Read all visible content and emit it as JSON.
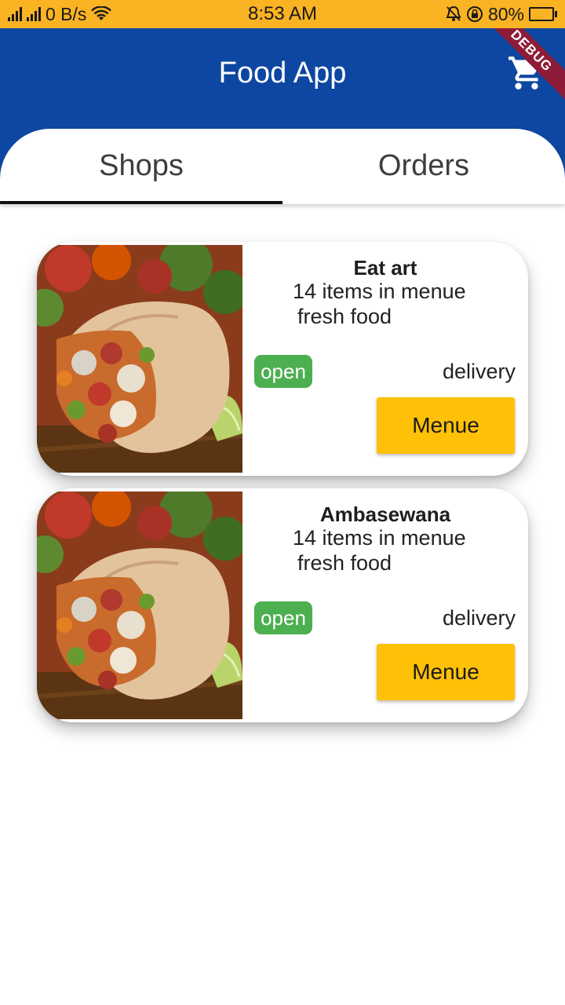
{
  "status_bar": {
    "net_speed": "0 B/s",
    "time": "8:53 AM",
    "battery": "80%",
    "battery_level": 0.8
  },
  "app_bar": {
    "title": "Food App",
    "cart_icon": "shopping-cart-icon",
    "debug_banner": "DEBUG"
  },
  "tabs": [
    {
      "label": "Shops",
      "selected": true
    },
    {
      "label": "Orders",
      "selected": false
    }
  ],
  "shops": [
    {
      "name": "Eat art",
      "items": "14 items in menue",
      "description": "fresh food",
      "status": "open",
      "delivery": "delivery",
      "button": "Menue",
      "image": "burrito-photo"
    },
    {
      "name": "Ambasewana",
      "items": "14 items in menue",
      "description": "fresh food",
      "status": "open",
      "delivery": "delivery",
      "button": "Menue",
      "image": "burrito-photo"
    }
  ],
  "colors": {
    "status_bar": "#f9b323",
    "app_bar": "#0d47a1",
    "open_badge": "#4caf50",
    "menu_button": "#ffc107",
    "debug_ribbon": "#8e1c38"
  }
}
